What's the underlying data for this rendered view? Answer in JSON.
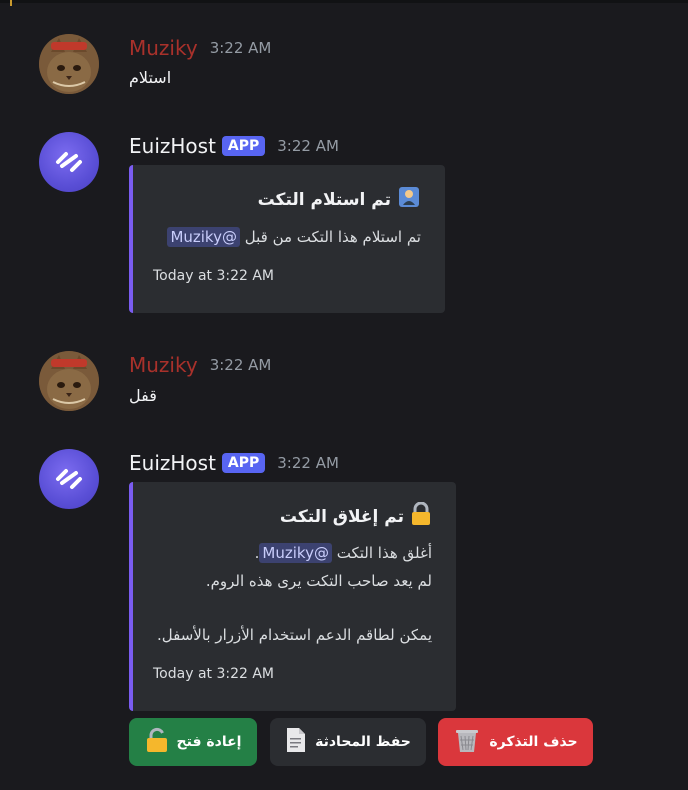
{
  "messages": [
    {
      "author": "Muziky",
      "time": "3:22 AM",
      "text": "استلام"
    },
    {
      "author": "EuizHost",
      "badge": "APP",
      "time": "3:22 AM",
      "embed": {
        "title": "تم استلام التكت",
        "icon": "manager-emoji-icon",
        "desc_prefix": "تم استلام هذا التكت من قبل",
        "mention": "@Muziky",
        "footer": "Today at 3:22 AM"
      }
    },
    {
      "author": "Muziky",
      "time": "3:22 AM",
      "text": "قفل"
    },
    {
      "author": "EuizHost",
      "badge": "APP",
      "time": "3:22 AM",
      "embed": {
        "title": "تم إغلاق التكت",
        "icon": "lock-emoji-icon",
        "line1_prefix": "أغلق هذا التكت",
        "mention": "@Muziky",
        "line1_suffix": ".",
        "line2": "لم يعد صاحب التكت يرى هذه الروم.",
        "line3": "يمكن لطاقم الدعم استخدام الأزرار بالأسفل.",
        "footer": "Today at 3:22 AM"
      }
    }
  ],
  "buttons": [
    {
      "label": "إعادة فتح",
      "icon": "unlock-icon",
      "color": "#248046"
    },
    {
      "label": "حفظ المحادثة",
      "icon": "document-icon",
      "color": "#2b2d31"
    },
    {
      "label": "حذف التذكرة",
      "icon": "wastebasket-icon",
      "color": "#da373c"
    }
  ],
  "colors": {
    "accent": "#5865f2",
    "embed_border": "#7a5cf0",
    "user_name": "#a9312b"
  }
}
